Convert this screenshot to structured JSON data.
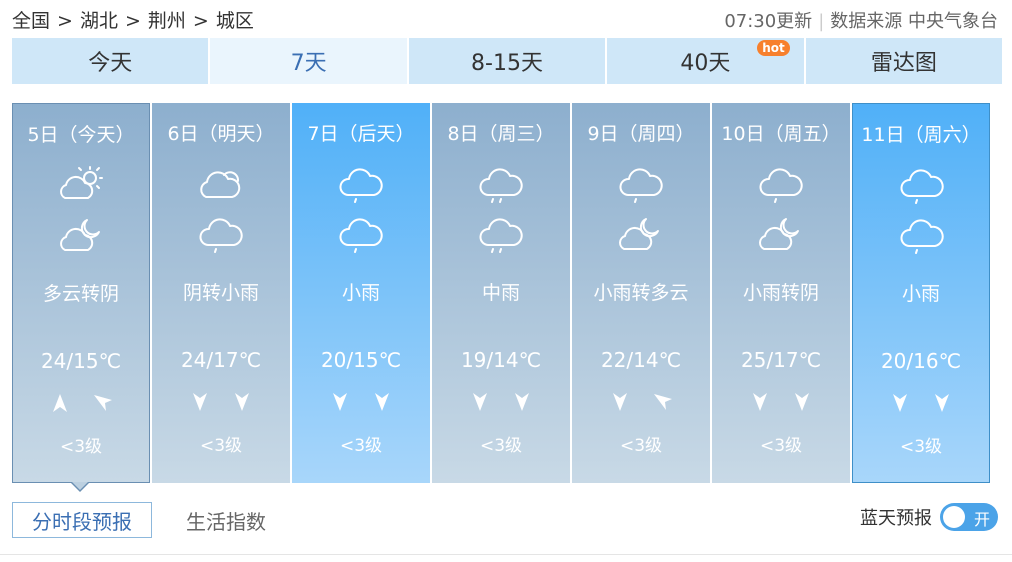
{
  "breadcrumb": {
    "items": [
      "全国",
      "湖北",
      "荆州",
      "城区"
    ],
    "separator": ">"
  },
  "meta": {
    "update_time": "07:30更新",
    "source": "数据来源 中央气象台"
  },
  "tabs": [
    {
      "label": "今天",
      "active": false
    },
    {
      "label": "7天",
      "active": true
    },
    {
      "label": "8-15天",
      "active": false
    },
    {
      "label": "40天",
      "active": false,
      "badge": "hot"
    },
    {
      "label": "雷达图",
      "active": false
    }
  ],
  "days": [
    {
      "date": "5日（今天）",
      "icon1": "cloudy-sun-icon",
      "icon2": "cloudy-night-icon",
      "desc": "多云转阴",
      "temp": "24/15℃",
      "wind1": "north-wind-icon",
      "wind2": "northwest-wind-icon",
      "level": "<3级",
      "style": "gray",
      "selected": true
    },
    {
      "date": "6日（明天）",
      "icon1": "cloud-icon",
      "icon2": "light-rain-icon",
      "desc": "阴转小雨",
      "temp": "24/17℃",
      "wind1": "south-wind-icon",
      "wind2": "south-wind-icon",
      "level": "<3级",
      "style": "gray"
    },
    {
      "date": "7日（后天）",
      "icon1": "light-rain-icon",
      "icon2": "light-rain-icon",
      "desc": "小雨",
      "temp": "20/15℃",
      "wind1": "south-wind-icon",
      "wind2": "south-wind-icon",
      "level": "<3级",
      "style": "rain"
    },
    {
      "date": "8日（周三）",
      "icon1": "moderate-rain-icon",
      "icon2": "moderate-rain-icon",
      "desc": "中雨",
      "temp": "19/14℃",
      "wind1": "south-wind-icon",
      "wind2": "south-wind-icon",
      "level": "<3级",
      "style": "gray"
    },
    {
      "date": "9日（周四）",
      "icon1": "light-rain-icon",
      "icon2": "cloudy-night-icon",
      "desc": "小雨转多云",
      "temp": "22/14℃",
      "wind1": "south-wind-icon",
      "wind2": "northwest-wind-icon",
      "level": "<3级",
      "style": "gray"
    },
    {
      "date": "10日（周五）",
      "icon1": "light-rain-icon",
      "icon2": "cloudy-night-icon",
      "desc": "小雨转阴",
      "temp": "25/17℃",
      "wind1": "south-wind-icon",
      "wind2": "south-wind-icon",
      "level": "<3级",
      "style": "gray"
    },
    {
      "date": "11日（周六）",
      "icon1": "light-rain-icon",
      "icon2": "light-rain-icon",
      "desc": "小雨",
      "temp": "20/16℃",
      "wind1": "south-wind-icon",
      "wind2": "south-wind-icon",
      "level": "<3级",
      "style": "rain"
    }
  ],
  "subtabs": {
    "hourly": "分时段预报",
    "life_index": "生活指数"
  },
  "blue_sky": {
    "label": "蓝天预报",
    "toggle_text": "开",
    "on": true
  },
  "colors": {
    "tab_bg": "#cfe7f8",
    "tab_active_text": "#3b6fb3",
    "rain_card": "#50b0f8",
    "gray_card": "#8dafce",
    "hot_badge": "#f7802d",
    "toggle_on": "#4ba3e8"
  }
}
